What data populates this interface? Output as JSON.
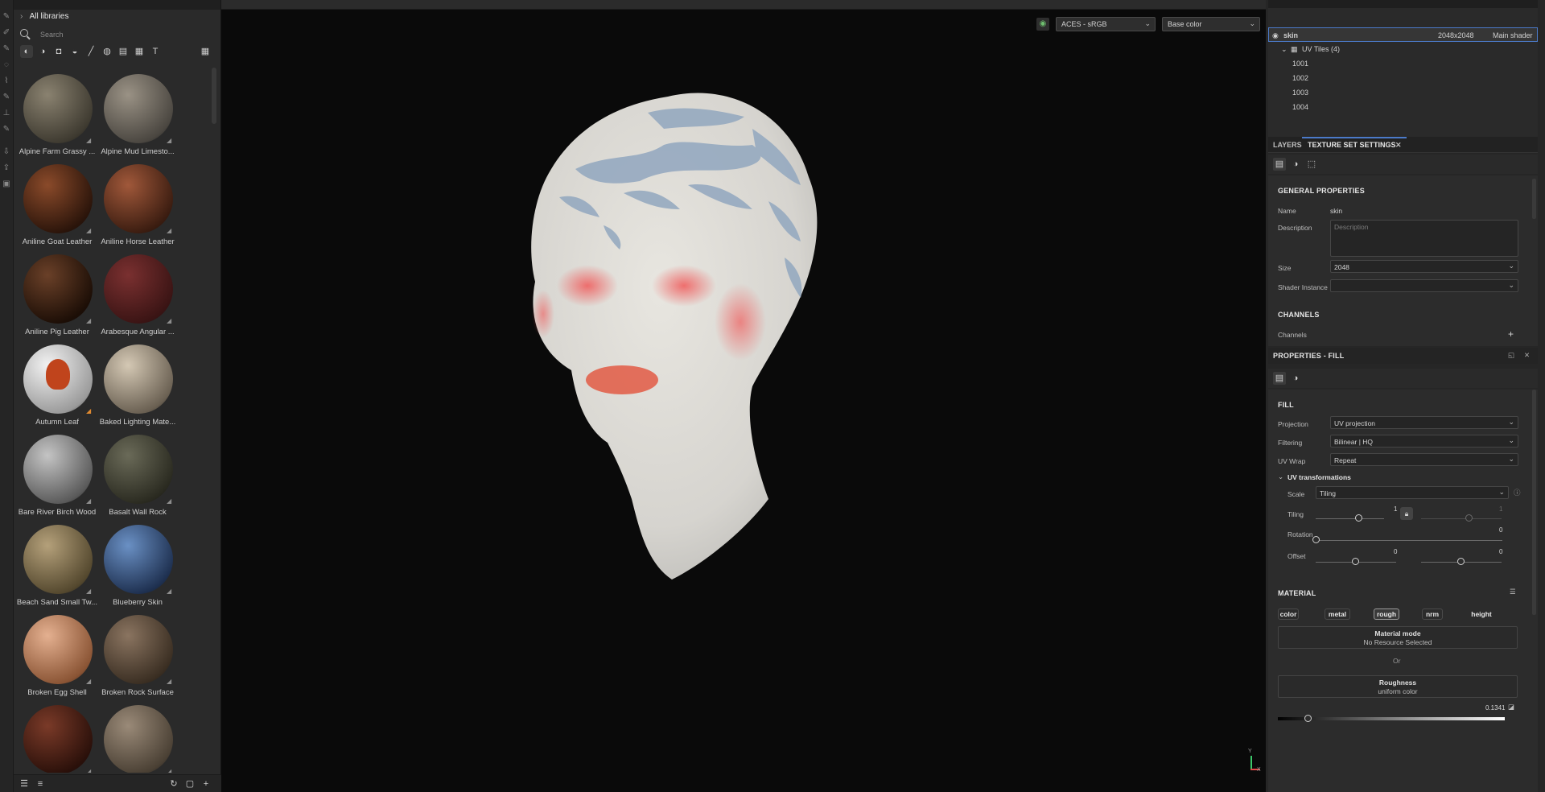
{
  "assets": {
    "library": "All libraries",
    "search_placeholder": "Search",
    "materials": [
      {
        "label": "Alpine Farm Grassy ...",
        "color1": "#8a8270",
        "color2": "#3e3a30"
      },
      {
        "label": "Alpine Mud Limesto...",
        "color1": "#9a9285",
        "color2": "#4a4640"
      },
      {
        "label": "Aniline Goat Leather",
        "color1": "#8a4a2a",
        "color2": "#2a140a"
      },
      {
        "label": "Aniline Horse Leather",
        "color1": "#a0583a",
        "color2": "#3a1c10"
      },
      {
        "label": "Aniline Pig Leather",
        "color1": "#6a4028",
        "color2": "#1c0e06"
      },
      {
        "label": "Arabesque Angular ...",
        "color1": "#7a3030",
        "color2": "#3a1414"
      },
      {
        "label": "Autumn Leaf",
        "color1": "#f2f2f2",
        "color2": "#9a9a9a"
      },
      {
        "label": "Baked Lighting Mate...",
        "color1": "#d4c8b4",
        "color2": "#6a6052"
      },
      {
        "label": "Bare River Birch Wood",
        "color1": "#c4c4c4",
        "color2": "#5a5a5a"
      },
      {
        "label": "Basalt Wall Rock",
        "color1": "#6a6a58",
        "color2": "#2a2a20"
      },
      {
        "label": "Beach Sand Small Tw...",
        "color1": "#b4a07a",
        "color2": "#54482e"
      },
      {
        "label": "Blueberry Skin",
        "color1": "#6a90c4",
        "color2": "#1e3050"
      },
      {
        "label": "Broken Egg Shell",
        "color1": "#e4b090",
        "color2": "#8a5434"
      },
      {
        "label": "Broken Rock Surface",
        "color1": "#8a7460",
        "color2": "#3a2e22"
      },
      {
        "label": "",
        "color1": "#7a3a28",
        "color2": "#2a100a"
      },
      {
        "label": "",
        "color1": "#9a8a78",
        "color2": "#4a4034"
      }
    ]
  },
  "viewport": {
    "colorspace": "ACES - sRGB",
    "channel_view": "Base color",
    "axis_y": "Y",
    "axis_x": "X"
  },
  "texture_set_list": {
    "name": "skin",
    "resolution": "2048x2048",
    "shader": "Main shader",
    "uv_tiles_label": "UV Tiles (4)",
    "tiles": [
      "1001",
      "1002",
      "1003",
      "1004"
    ]
  },
  "tabs": {
    "layers": "LAYERS",
    "texture_set_settings": "TEXTURE SET SETTINGS"
  },
  "settings": {
    "general_title": "GENERAL PROPERTIES",
    "name_label": "Name",
    "name_value": "skin",
    "description_label": "Description",
    "description_placeholder": "Description",
    "size_label": "Size",
    "size_value": "2048",
    "shader_label": "Shader Instance",
    "shader_value": "",
    "channels_title": "CHANNELS",
    "channels_label": "Channels"
  },
  "properties": {
    "title": "PROPERTIES - FILL",
    "fill_title": "FILL",
    "projection_label": "Projection",
    "projection_value": "UV projection",
    "filtering_label": "Filtering",
    "filtering_value": "Bilinear | HQ",
    "uvwrap_label": "UV Wrap",
    "uvwrap_value": "Repeat",
    "uvtransform_title": "UV transformations",
    "scale_label": "Scale",
    "scale_value": "Tiling",
    "tiling_label": "Tiling",
    "tiling_value_1": "1",
    "tiling_value_2": "1",
    "rotation_label": "Rotation",
    "rotation_value": "0",
    "offset_label": "Offset",
    "offset_value_1": "0",
    "offset_value_2": "0",
    "material_title": "MATERIAL",
    "material_pills": [
      "color",
      "metal",
      "rough",
      "nrm",
      "height"
    ],
    "material_mode_title": "Material mode",
    "material_mode_value": "No Resource Selected",
    "or_label": "Or",
    "roughness_title": "Roughness",
    "roughness_sub": "uniform color",
    "roughness_value": "0.1341",
    "roughness_fraction": 0.1341
  }
}
